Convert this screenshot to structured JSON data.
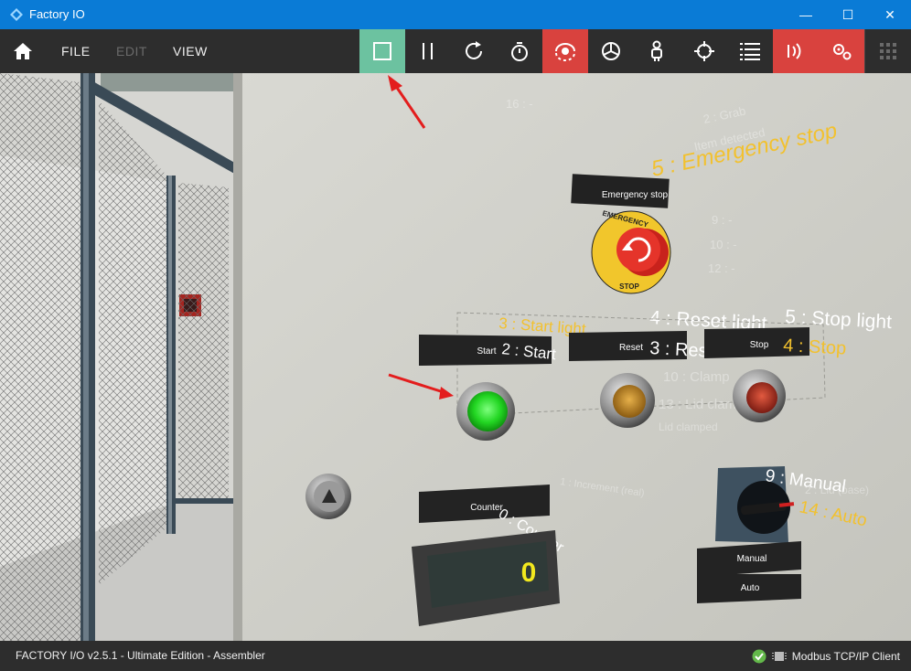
{
  "window": {
    "title": "Factory IO",
    "minimize": "—",
    "maximize": "☐",
    "close": "✕"
  },
  "menu": {
    "file": "FILE",
    "edit": "EDIT",
    "view": "VIEW"
  },
  "toolbar": {
    "icons": [
      "home-icon",
      "stop-icon",
      "pause-icon",
      "reset-icon",
      "timer-icon",
      "camera-orbit-icon",
      "camera-fly-icon",
      "camera-first-person-icon",
      "pick-icon",
      "tag-list-icon",
      "sensors-icon",
      "drivers-icon",
      "grid-icon"
    ],
    "active_color": "#6cc2a0",
    "highlight_color": "#d9423e"
  },
  "panel": {
    "emergency": {
      "plate": "Emergency stop",
      "tag": "5 : Emergency stop",
      "ring_top": "EMERGENCY",
      "ring_bottom": "STOP"
    },
    "start": {
      "plate": "Start",
      "tag": "2 : Start",
      "light_tag": "3 : Start light"
    },
    "reset": {
      "plate": "Reset",
      "tag": "3 : Reset",
      "light_tag": "4 : Reset light"
    },
    "stop": {
      "plate": "Stop",
      "tag": "4 : Stop",
      "light_tag": "5 : Stop light"
    },
    "counter": {
      "plate": "Counter",
      "tag": "0 : Counter",
      "value": "0"
    },
    "selector": {
      "manual_tag": "9 : Manual",
      "auto_tag": "14 : Auto",
      "manual_plate": "Manual",
      "auto_plate": "Auto"
    },
    "ghost": {
      "g1": "16 : -",
      "g2": "2 : Grab",
      "g3": "Item detected",
      "g4": "9 : -",
      "g5": "10 : -",
      "g6": "12 : -",
      "g7": "10 : Clamp",
      "g8": "13 : Lid clamped",
      "g9": "Lid clamped",
      "g10": "1 : Increment (real)",
      "g11": "2 : Lid (base)"
    }
  },
  "status": {
    "left": "FACTORY I/O v2.5.1 - Ultimate Edition - Assembler",
    "driver": "Modbus TCP/IP Client"
  }
}
